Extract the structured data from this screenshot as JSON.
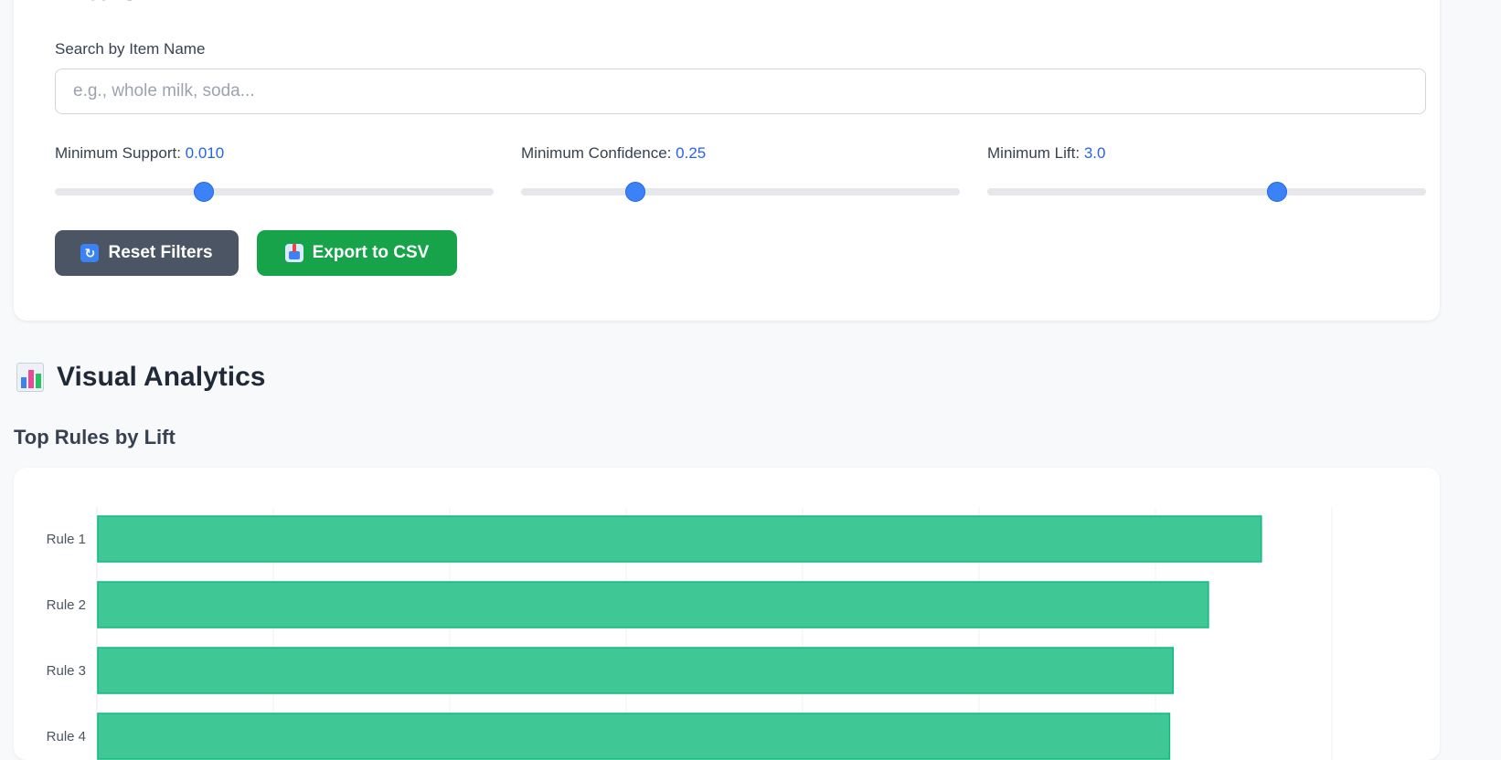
{
  "filters": {
    "title": "Filters",
    "search": {
      "label": "Search by Item Name",
      "placeholder": "e.g., whole milk, soda...",
      "value": ""
    },
    "sliders": [
      {
        "label": "Minimum Support:",
        "value": "0.010",
        "position": 0.34
      },
      {
        "label": "Minimum Confidence:",
        "value": "0.25",
        "position": 0.26
      },
      {
        "label": "Minimum Lift:",
        "value": "3.0",
        "position": 0.66
      }
    ],
    "buttons": {
      "reset_label": "Reset Filters",
      "reset_icon": "refresh-icon",
      "export_label": "Export to CSV",
      "export_icon": "export-tray-icon"
    }
  },
  "analytics": {
    "title": "Visual Analytics",
    "icon": "bar-chart-icon",
    "chart_title": "Top Rules by Lift"
  },
  "colors": {
    "accent": "#3b82f6",
    "reset_button": "#4b5563",
    "export_button": "#16a34a",
    "bar_fill": "#3fc896",
    "bar_stroke": "#10b981"
  },
  "chart_data": {
    "type": "bar",
    "orientation": "horizontal",
    "title": "Top Rules by Lift",
    "categories": [
      "Rule 1",
      "Rule 2",
      "Rule 3",
      "Rule 4"
    ],
    "values": [
      6.6,
      6.3,
      6.1,
      6.08
    ],
    "xlim": [
      0,
      7
    ],
    "grid": true
  }
}
